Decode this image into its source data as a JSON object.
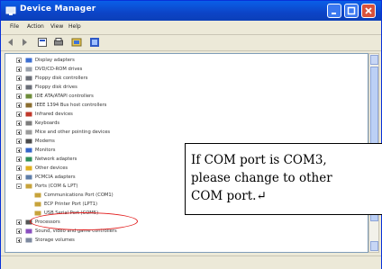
{
  "window": {
    "title": "Device Manager"
  },
  "menu": [
    "File",
    "Action",
    "View",
    "Help"
  ],
  "toolbar_icons": [
    "back-icon",
    "forward-icon",
    "properties-icon",
    "print-icon",
    "help-icon",
    "scan-hardware-icon"
  ],
  "tree": [
    {
      "label": "Display adapters",
      "icon": "display-icon",
      "level": 1,
      "expander": "plus"
    },
    {
      "label": "DVD/CD-ROM drives",
      "icon": "cdrom-icon",
      "level": 1,
      "expander": "plus"
    },
    {
      "label": "Floppy disk controllers",
      "icon": "floppy-icon",
      "level": 1,
      "expander": "plus"
    },
    {
      "label": "Floppy disk drives",
      "icon": "floppy-icon",
      "level": 1,
      "expander": "plus"
    },
    {
      "label": "IDE ATA/ATAPI controllers",
      "icon": "ide-icon",
      "level": 1,
      "expander": "plus"
    },
    {
      "label": "IEEE 1394 Bus host controllers",
      "icon": "ieee1394-icon",
      "level": 1,
      "expander": "plus"
    },
    {
      "label": "Infrared devices",
      "icon": "infrared-icon",
      "level": 1,
      "expander": "plus"
    },
    {
      "label": "Keyboards",
      "icon": "keyboard-icon",
      "level": 1,
      "expander": "plus"
    },
    {
      "label": "Mice and other pointing devices",
      "icon": "mouse-icon",
      "level": 1,
      "expander": "plus"
    },
    {
      "label": "Modems",
      "icon": "modem-icon",
      "level": 1,
      "expander": "plus"
    },
    {
      "label": "Monitors",
      "icon": "monitor-icon",
      "level": 1,
      "expander": "plus"
    },
    {
      "label": "Network adapters",
      "icon": "network-icon",
      "level": 1,
      "expander": "plus"
    },
    {
      "label": "Other devices",
      "icon": "question-icon",
      "level": 1,
      "expander": "plus"
    },
    {
      "label": "PCMCIA adapters",
      "icon": "pcmcia-icon",
      "level": 1,
      "expander": "plus"
    },
    {
      "label": "Ports (COM & LPT)",
      "icon": "port-icon",
      "level": 1,
      "expander": "minus"
    },
    {
      "label": "Communications Port (COM1)",
      "icon": "port-icon",
      "level": 2,
      "expander": "none"
    },
    {
      "label": "ECP Printer Port (LPT1)",
      "icon": "port-icon",
      "level": 2,
      "expander": "none"
    },
    {
      "label": "USB Serial Port (COM5)",
      "icon": "port-icon",
      "level": 2,
      "expander": "none"
    },
    {
      "label": "Processors",
      "icon": "cpu-icon",
      "level": 1,
      "expander": "plus"
    },
    {
      "label": "Sound, video and game controllers",
      "icon": "sound-icon",
      "level": 1,
      "expander": "plus"
    },
    {
      "label": "Storage volumes",
      "icon": "storage-icon",
      "level": 1,
      "expander": "plus"
    }
  ],
  "annotation": {
    "line1": "If COM port is COM3,",
    "line2": "please change to other",
    "line3": "COM port.↵"
  },
  "colors": {
    "titlebar": "#0c44c7",
    "highlight": "#e21c1c",
    "window": "#ece9d8"
  }
}
